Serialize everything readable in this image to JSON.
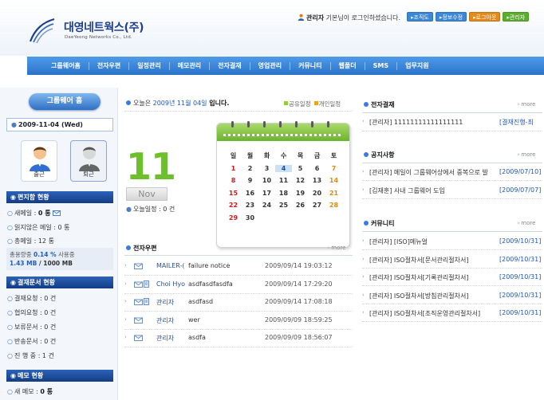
{
  "header": {
    "logo_korean": "대영네트웍스(주)",
    "logo_english": "DaeYeong Networks Co., Ltd.",
    "welcome_name": "관리자",
    "welcome_text": " 기본님이 로그인하셨습니다.",
    "buttons": [
      {
        "label": "▸조직도",
        "color": "#3a86d9"
      },
      {
        "label": "▸정보수정",
        "color": "#3a86d9"
      },
      {
        "label": "▸로그아웃",
        "color": "#e48a1b"
      },
      {
        "label": "▸관리자",
        "color": "#5aae2c"
      }
    ]
  },
  "nav": {
    "items": [
      "그룹웨어홈",
      "전자우편",
      "일정관리",
      "메모관리",
      "전자결재",
      "영업관리",
      "커뮤니티",
      "웹폴더",
      "SMS",
      "업무지원"
    ]
  },
  "left": {
    "home_button": "그룹웨어 홈",
    "date": "2009-11-04 (Wed)",
    "checkin": "출근",
    "checkout": "퇴근",
    "mail_section": "편지함 현황",
    "new_mail_label": "새메일 : ",
    "new_mail_value": "0 통",
    "unread_label": "읽지않은 메일 : 0 통",
    "total_label": "총메일 : 12 통",
    "usage_line1_a": "총용량중 ",
    "usage_line1_b": "0.14 %",
    "usage_line1_c": " 사용중",
    "usage_line2_a": "1.43 MB",
    "usage_line2_b": " / 1000 MB",
    "approval_section": "결재문서 현황",
    "approval_items": [
      "결재요청 : 0 건",
      "협의요청 : 0 건",
      "보류문서 : 0 건",
      "반송문서 : 0 건",
      "진 행 중 : 1 건"
    ],
    "memo_section": "메모 현황",
    "new_memo_label": "새 메모 : ",
    "new_memo_value": "0 통"
  },
  "today": {
    "prefix": "오늘은 ",
    "date_text": "2009년 11월 04일",
    "suffix": " 입니다.",
    "legend_shared": "공유일정",
    "legend_personal": "개인일정",
    "legend_shared_color": "#8fcf3a",
    "legend_personal_color": "#f0a020",
    "day": "11",
    "month": "Nov",
    "today_schedule": "오늘일정 : 0 건"
  },
  "calendar": {
    "weekdays": [
      "일",
      "월",
      "화",
      "수",
      "목",
      "금",
      "토"
    ],
    "weeks": [
      [
        "1",
        "2",
        "3",
        "4",
        "5",
        "6",
        "7"
      ],
      [
        "8",
        "9",
        "10",
        "11",
        "12",
        "13",
        "14"
      ],
      [
        "15",
        "16",
        "17",
        "18",
        "19",
        "20",
        "21"
      ],
      [
        "22",
        "23",
        "24",
        "25",
        "26",
        "27",
        "28"
      ],
      [
        "29",
        "30",
        "",
        "",
        "",
        "",
        ""
      ]
    ],
    "today": "4"
  },
  "email": {
    "title": "전자우편",
    "more": "more",
    "rows": [
      {
        "sender": "MAILER-(",
        "subject": "failure notice",
        "time": "2009/09/14 19:03:12",
        "attach": false
      },
      {
        "sender": "Choi Hyo",
        "subject": "asdfasdfasdfa",
        "time": "2009/09/14 17:29:20",
        "attach": true
      },
      {
        "sender": "관리자",
        "subject": "asdfasd",
        "time": "2009/09/14 17:08:18",
        "attach": true
      },
      {
        "sender": "관리자",
        "subject": "wer",
        "time": "2009/09/09 18:59:25",
        "attach": false
      },
      {
        "sender": "관리자",
        "subject": "asdfa",
        "time": "2009/09/09 18:56:07",
        "attach": false
      }
    ]
  },
  "approval": {
    "title": "전자결재",
    "more": "more",
    "rows": [
      {
        "text": "[관리자] 11111111111111111",
        "date": "[결재진행-최"
      }
    ]
  },
  "notice": {
    "title": "공지사항",
    "more": "more",
    "rows": [
      {
        "text": "[관리자] 메일이 그룹웨어상에서 중복으로 발",
        "date": "[2009/07/10]"
      },
      {
        "text": "[김재훈] 사내 그룹웨어 도입",
        "date": "[2009/07/07]"
      }
    ]
  },
  "community": {
    "title": "커뮤니티",
    "more": "more",
    "rows": [
      {
        "text": "[관리자] [ISO]메뉴얼",
        "date": "[2009/10/31]"
      },
      {
        "text": "[관리자] ISO절차서[문서관리절차서]",
        "date": "[2009/10/31]"
      },
      {
        "text": "[관리자] ISO절차서[기록관리절차서]",
        "date": "[2009/10/31]"
      },
      {
        "text": "[관리자] ISO절차서[방침관리절차서]",
        "date": "[2009/10/31]"
      },
      {
        "text": "[관리자] ISO절차서[조직운영관리절차서]",
        "date": "[2009/10/31]"
      }
    ]
  }
}
